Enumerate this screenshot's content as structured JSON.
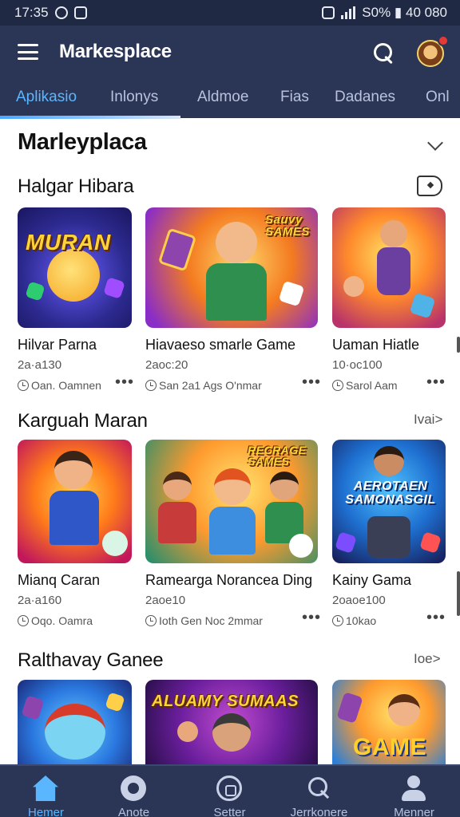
{
  "status_bar": {
    "time": "17:35",
    "right_text": "S0% ▮ 40 080"
  },
  "app_bar": {
    "title": "Markesplace"
  },
  "tabs": [
    {
      "label": "Aplikasio",
      "active": true
    },
    {
      "label": "Inlonys",
      "active": false
    },
    {
      "label": "Aldmoe",
      "active": false
    },
    {
      "label": "Fias",
      "active": false
    },
    {
      "label": "Dadanes",
      "active": false
    },
    {
      "label": "Onl",
      "active": false
    }
  ],
  "page": {
    "title": "Marleyplaca"
  },
  "sections": [
    {
      "title": "Halgar Hibara",
      "cards": [
        {
          "name": "Hilvar Parna",
          "meta": "2a·a130",
          "sub": "Oan. Oamnen",
          "banner": "MURAN"
        },
        {
          "name": "Hiavaeso smarle Game",
          "meta": "2aoc:20",
          "sub": "San 2a1 Ags O'nmar",
          "banner": "Sauvy SAMES"
        },
        {
          "name": "Uaman Hiatle",
          "meta": "10·oc100",
          "sub": "Sarol Aam",
          "banner": ""
        }
      ]
    },
    {
      "title": "Karguah Maran",
      "see_more": "Ivai>",
      "cards": [
        {
          "name": "Mianq Caran",
          "meta": "2a·a160",
          "sub": "Oqo. Oamra",
          "banner": ""
        },
        {
          "name": "Ramearga Norancea Ding",
          "meta": "2aoe10",
          "sub": "Ioth Gen Noc 2mmar",
          "banner": "RECRAGE SAMES"
        },
        {
          "name": "Kainy Gama",
          "meta": "2oaoe100",
          "sub": "10kao",
          "banner": "AEROTAEN SAMONASGIL"
        }
      ]
    },
    {
      "title": "Ralthavay Ganee",
      "see_more": "Ioe>",
      "cards": [
        {
          "name": "",
          "meta": "",
          "sub": "",
          "banner": ""
        },
        {
          "name": "",
          "meta": "",
          "sub": "",
          "banner": "ALUAMY  SUMAAS"
        },
        {
          "name": "",
          "meta": "",
          "sub": "",
          "banner": "GAME"
        }
      ]
    }
  ],
  "bottom_nav": [
    {
      "label": "Hemer",
      "icon": "home-icon",
      "active": true
    },
    {
      "label": "Anote",
      "icon": "apps-icon",
      "active": false
    },
    {
      "label": "Setter",
      "icon": "store-icon",
      "active": false
    },
    {
      "label": "Jerrkonere",
      "icon": "search-icon",
      "active": false
    },
    {
      "label": "Menner",
      "icon": "user-icon",
      "active": false
    }
  ],
  "colors": {
    "app_bar": "#2b3657",
    "accent": "#5ab6ff",
    "status_bar": "#1f2943"
  }
}
